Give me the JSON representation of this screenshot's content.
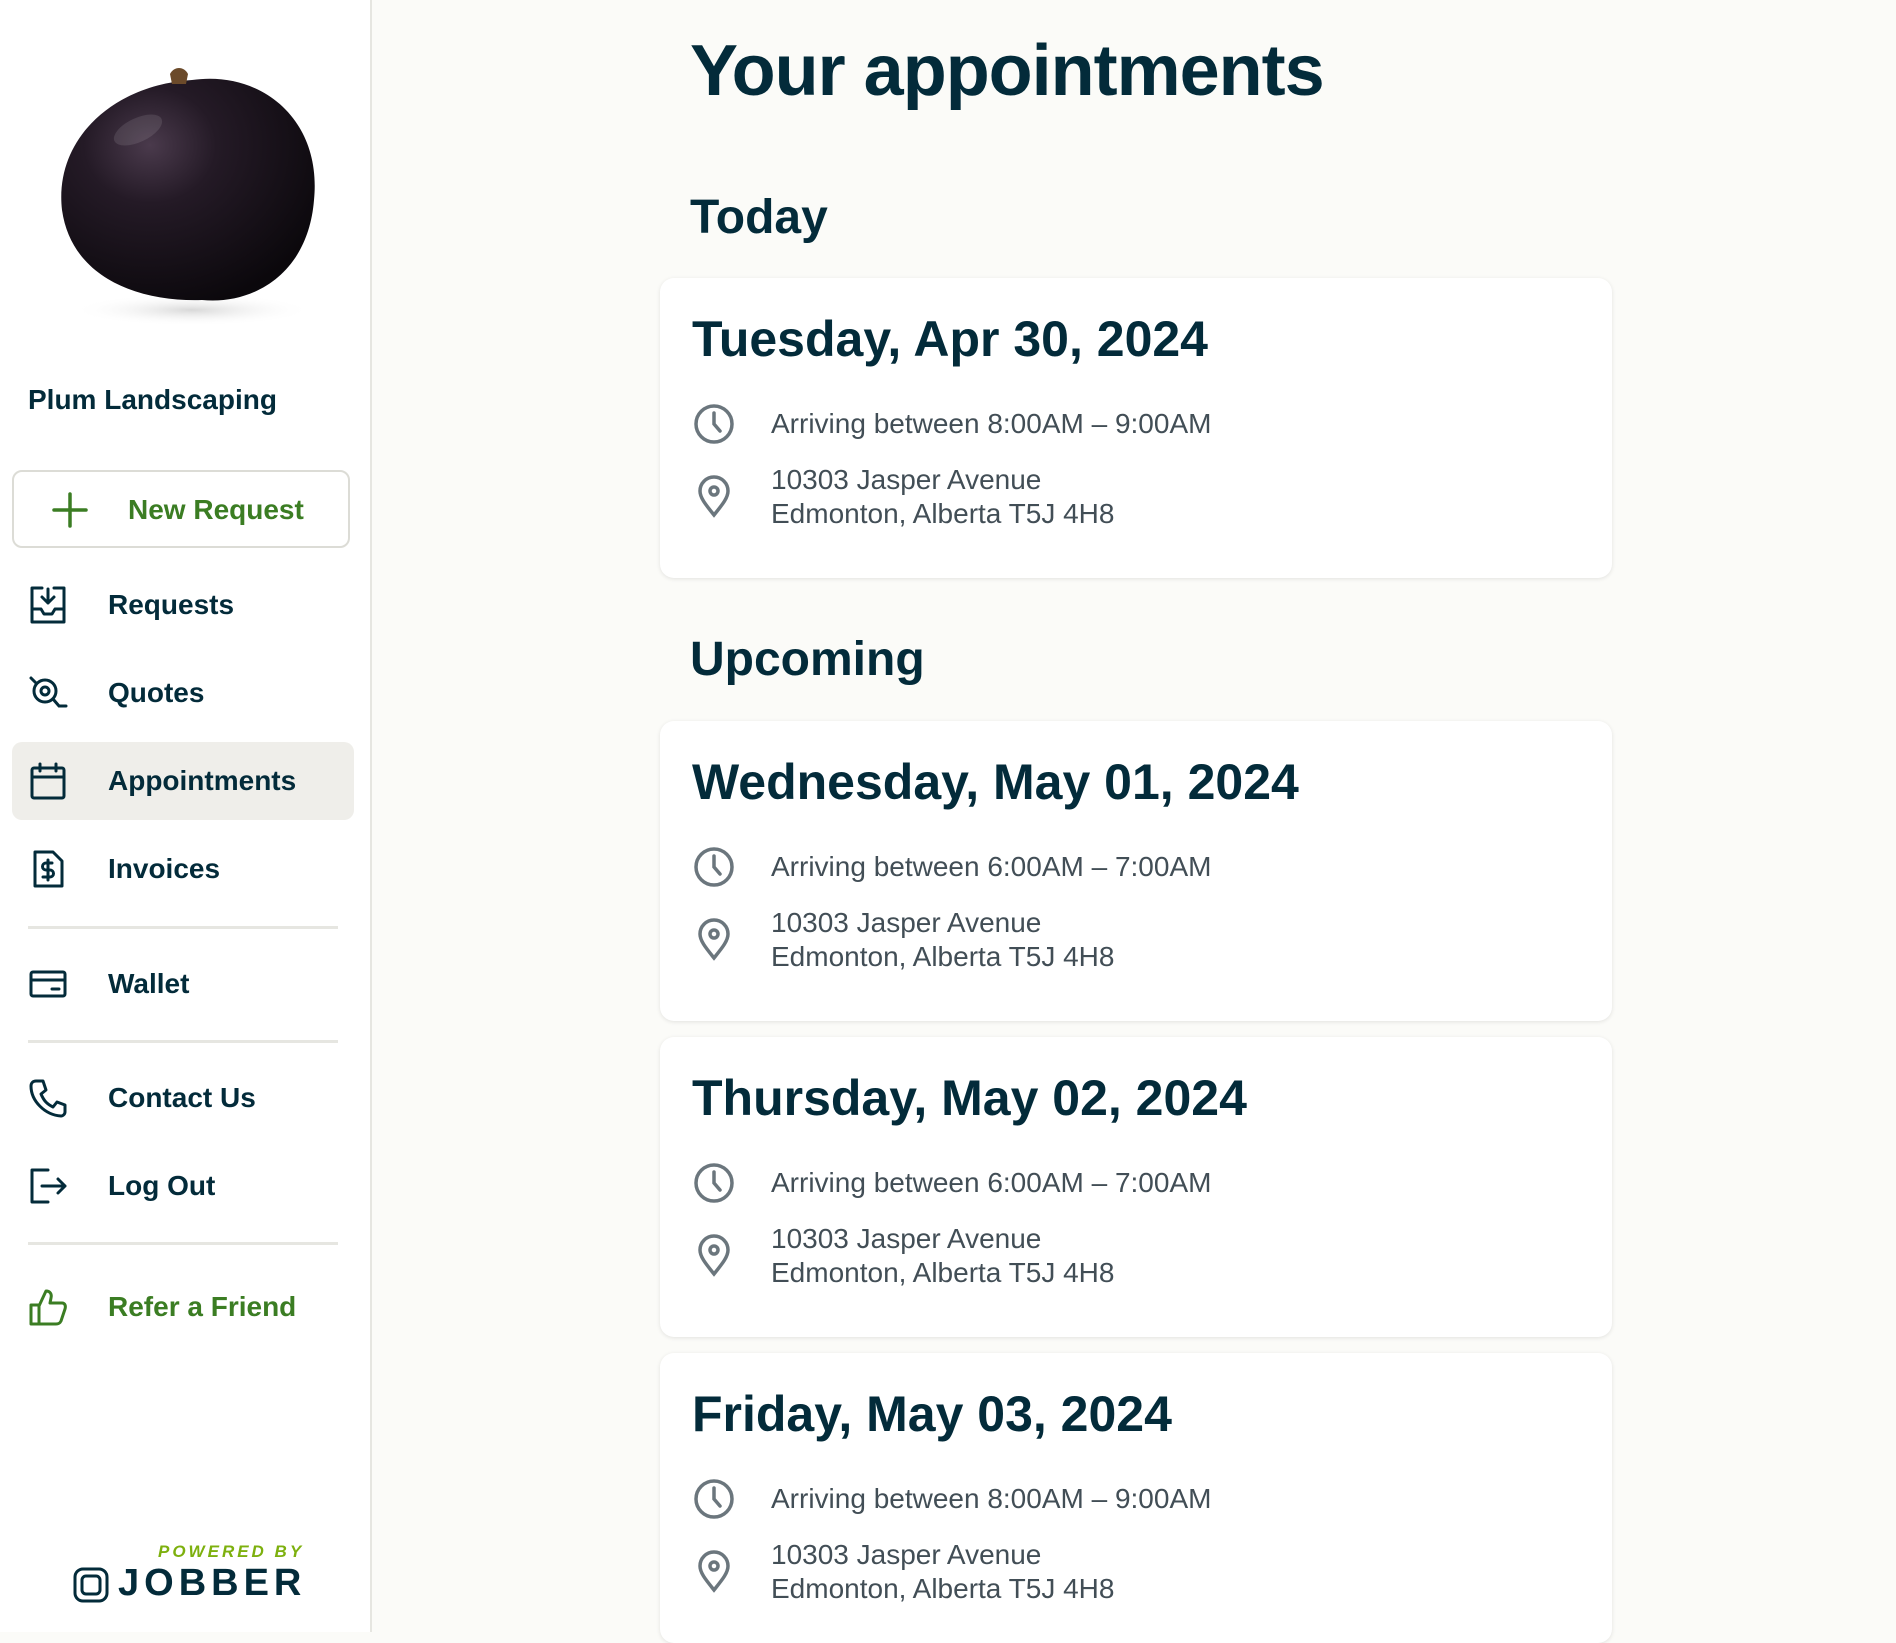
{
  "sidebar": {
    "company_name": "Plum Landscaping",
    "logo": "plum-logo",
    "new_request_label": "New Request",
    "items": [
      {
        "label": "Requests",
        "icon": "inbox-download-icon"
      },
      {
        "label": "Quotes",
        "icon": "quote-magnifier-icon"
      },
      {
        "label": "Appointments",
        "icon": "calendar-icon",
        "active": true
      },
      {
        "label": "Invoices",
        "icon": "invoice-dollar-icon"
      },
      {
        "label": "Wallet",
        "icon": "wallet-card-icon"
      },
      {
        "label": "Contact Us",
        "icon": "phone-icon"
      },
      {
        "label": "Log Out",
        "icon": "logout-icon"
      },
      {
        "label": "Refer a Friend",
        "icon": "thumbs-up-icon"
      }
    ],
    "powered_by": "POWERED BY",
    "brand": "JOBBER"
  },
  "main": {
    "title": "Your appointments",
    "sections": [
      {
        "title": "Today",
        "appointments": [
          {
            "date": "Tuesday, Apr 30, 2024",
            "time": "Arriving between 8:00AM – 9:00AM",
            "address_line1": "10303 Jasper Avenue",
            "address_line2": "Edmonton, Alberta T5J 4H8"
          }
        ]
      },
      {
        "title": "Upcoming",
        "appointments": [
          {
            "date": "Wednesday, May 01, 2024",
            "time": "Arriving between 6:00AM – 7:00AM",
            "address_line1": "10303 Jasper Avenue",
            "address_line2": "Edmonton, Alberta T5J 4H8"
          },
          {
            "date": "Thursday, May 02, 2024",
            "time": "Arriving between 6:00AM – 7:00AM",
            "address_line1": "10303 Jasper Avenue",
            "address_line2": "Edmonton, Alberta T5J 4H8"
          },
          {
            "date": "Friday, May 03, 2024",
            "time": "Arriving between 8:00AM – 9:00AM",
            "address_line1": "10303 Jasper Avenue",
            "address_line2": "Edmonton, Alberta T5J 4H8"
          }
        ]
      }
    ]
  },
  "colors": {
    "text_primary": "#032b3a",
    "accent_green": "#3b7d23",
    "powered_green": "#7db00e",
    "background": "#fbfbf8",
    "active_bg": "#efeeea"
  }
}
